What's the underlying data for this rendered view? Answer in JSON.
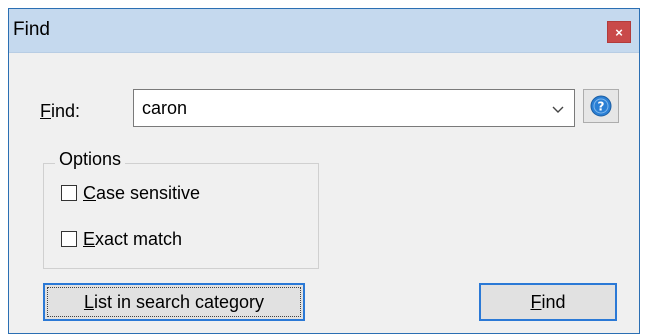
{
  "window": {
    "title": "Find",
    "close_label": "×"
  },
  "find": {
    "label_accel": "F",
    "label_rest": "ind:",
    "value": "caron"
  },
  "options": {
    "group_label": "Options",
    "case_sensitive": {
      "accel": "C",
      "rest": "ase sensitive",
      "checked": false
    },
    "exact_match": {
      "accel": "E",
      "rest": "xact match",
      "checked": false
    }
  },
  "buttons": {
    "list_accel": "L",
    "list_rest": "ist in search category",
    "find_accel": "F",
    "find_rest": "ind"
  },
  "icons": {
    "combo_arrow": "chevron-down-icon",
    "help": "help-icon"
  },
  "colors": {
    "titlebar": "#c5d9ee",
    "close": "#c94a4a",
    "focus_border": "#2b79d6",
    "help_icon": "#2a7fd4"
  }
}
